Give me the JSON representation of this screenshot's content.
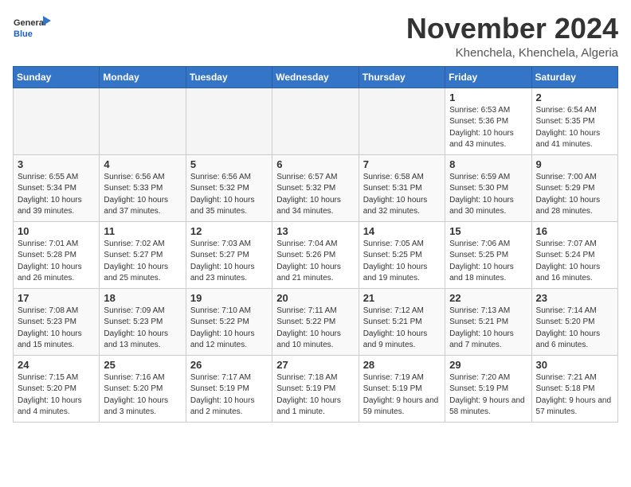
{
  "header": {
    "logo_general": "General",
    "logo_blue": "Blue",
    "month_title": "November 2024",
    "location": "Khenchela, Khenchela, Algeria"
  },
  "weekdays": [
    "Sunday",
    "Monday",
    "Tuesday",
    "Wednesday",
    "Thursday",
    "Friday",
    "Saturday"
  ],
  "weeks": [
    [
      {
        "day": "",
        "info": ""
      },
      {
        "day": "",
        "info": ""
      },
      {
        "day": "",
        "info": ""
      },
      {
        "day": "",
        "info": ""
      },
      {
        "day": "",
        "info": ""
      },
      {
        "day": "1",
        "info": "Sunrise: 6:53 AM\nSunset: 5:36 PM\nDaylight: 10 hours and 43 minutes."
      },
      {
        "day": "2",
        "info": "Sunrise: 6:54 AM\nSunset: 5:35 PM\nDaylight: 10 hours and 41 minutes."
      }
    ],
    [
      {
        "day": "3",
        "info": "Sunrise: 6:55 AM\nSunset: 5:34 PM\nDaylight: 10 hours and 39 minutes."
      },
      {
        "day": "4",
        "info": "Sunrise: 6:56 AM\nSunset: 5:33 PM\nDaylight: 10 hours and 37 minutes."
      },
      {
        "day": "5",
        "info": "Sunrise: 6:56 AM\nSunset: 5:32 PM\nDaylight: 10 hours and 35 minutes."
      },
      {
        "day": "6",
        "info": "Sunrise: 6:57 AM\nSunset: 5:32 PM\nDaylight: 10 hours and 34 minutes."
      },
      {
        "day": "7",
        "info": "Sunrise: 6:58 AM\nSunset: 5:31 PM\nDaylight: 10 hours and 32 minutes."
      },
      {
        "day": "8",
        "info": "Sunrise: 6:59 AM\nSunset: 5:30 PM\nDaylight: 10 hours and 30 minutes."
      },
      {
        "day": "9",
        "info": "Sunrise: 7:00 AM\nSunset: 5:29 PM\nDaylight: 10 hours and 28 minutes."
      }
    ],
    [
      {
        "day": "10",
        "info": "Sunrise: 7:01 AM\nSunset: 5:28 PM\nDaylight: 10 hours and 26 minutes."
      },
      {
        "day": "11",
        "info": "Sunrise: 7:02 AM\nSunset: 5:27 PM\nDaylight: 10 hours and 25 minutes."
      },
      {
        "day": "12",
        "info": "Sunrise: 7:03 AM\nSunset: 5:27 PM\nDaylight: 10 hours and 23 minutes."
      },
      {
        "day": "13",
        "info": "Sunrise: 7:04 AM\nSunset: 5:26 PM\nDaylight: 10 hours and 21 minutes."
      },
      {
        "day": "14",
        "info": "Sunrise: 7:05 AM\nSunset: 5:25 PM\nDaylight: 10 hours and 19 minutes."
      },
      {
        "day": "15",
        "info": "Sunrise: 7:06 AM\nSunset: 5:25 PM\nDaylight: 10 hours and 18 minutes."
      },
      {
        "day": "16",
        "info": "Sunrise: 7:07 AM\nSunset: 5:24 PM\nDaylight: 10 hours and 16 minutes."
      }
    ],
    [
      {
        "day": "17",
        "info": "Sunrise: 7:08 AM\nSunset: 5:23 PM\nDaylight: 10 hours and 15 minutes."
      },
      {
        "day": "18",
        "info": "Sunrise: 7:09 AM\nSunset: 5:23 PM\nDaylight: 10 hours and 13 minutes."
      },
      {
        "day": "19",
        "info": "Sunrise: 7:10 AM\nSunset: 5:22 PM\nDaylight: 10 hours and 12 minutes."
      },
      {
        "day": "20",
        "info": "Sunrise: 7:11 AM\nSunset: 5:22 PM\nDaylight: 10 hours and 10 minutes."
      },
      {
        "day": "21",
        "info": "Sunrise: 7:12 AM\nSunset: 5:21 PM\nDaylight: 10 hours and 9 minutes."
      },
      {
        "day": "22",
        "info": "Sunrise: 7:13 AM\nSunset: 5:21 PM\nDaylight: 10 hours and 7 minutes."
      },
      {
        "day": "23",
        "info": "Sunrise: 7:14 AM\nSunset: 5:20 PM\nDaylight: 10 hours and 6 minutes."
      }
    ],
    [
      {
        "day": "24",
        "info": "Sunrise: 7:15 AM\nSunset: 5:20 PM\nDaylight: 10 hours and 4 minutes."
      },
      {
        "day": "25",
        "info": "Sunrise: 7:16 AM\nSunset: 5:20 PM\nDaylight: 10 hours and 3 minutes."
      },
      {
        "day": "26",
        "info": "Sunrise: 7:17 AM\nSunset: 5:19 PM\nDaylight: 10 hours and 2 minutes."
      },
      {
        "day": "27",
        "info": "Sunrise: 7:18 AM\nSunset: 5:19 PM\nDaylight: 10 hours and 1 minute."
      },
      {
        "day": "28",
        "info": "Sunrise: 7:19 AM\nSunset: 5:19 PM\nDaylight: 9 hours and 59 minutes."
      },
      {
        "day": "29",
        "info": "Sunrise: 7:20 AM\nSunset: 5:19 PM\nDaylight: 9 hours and 58 minutes."
      },
      {
        "day": "30",
        "info": "Sunrise: 7:21 AM\nSunset: 5:18 PM\nDaylight: 9 hours and 57 minutes."
      }
    ]
  ]
}
